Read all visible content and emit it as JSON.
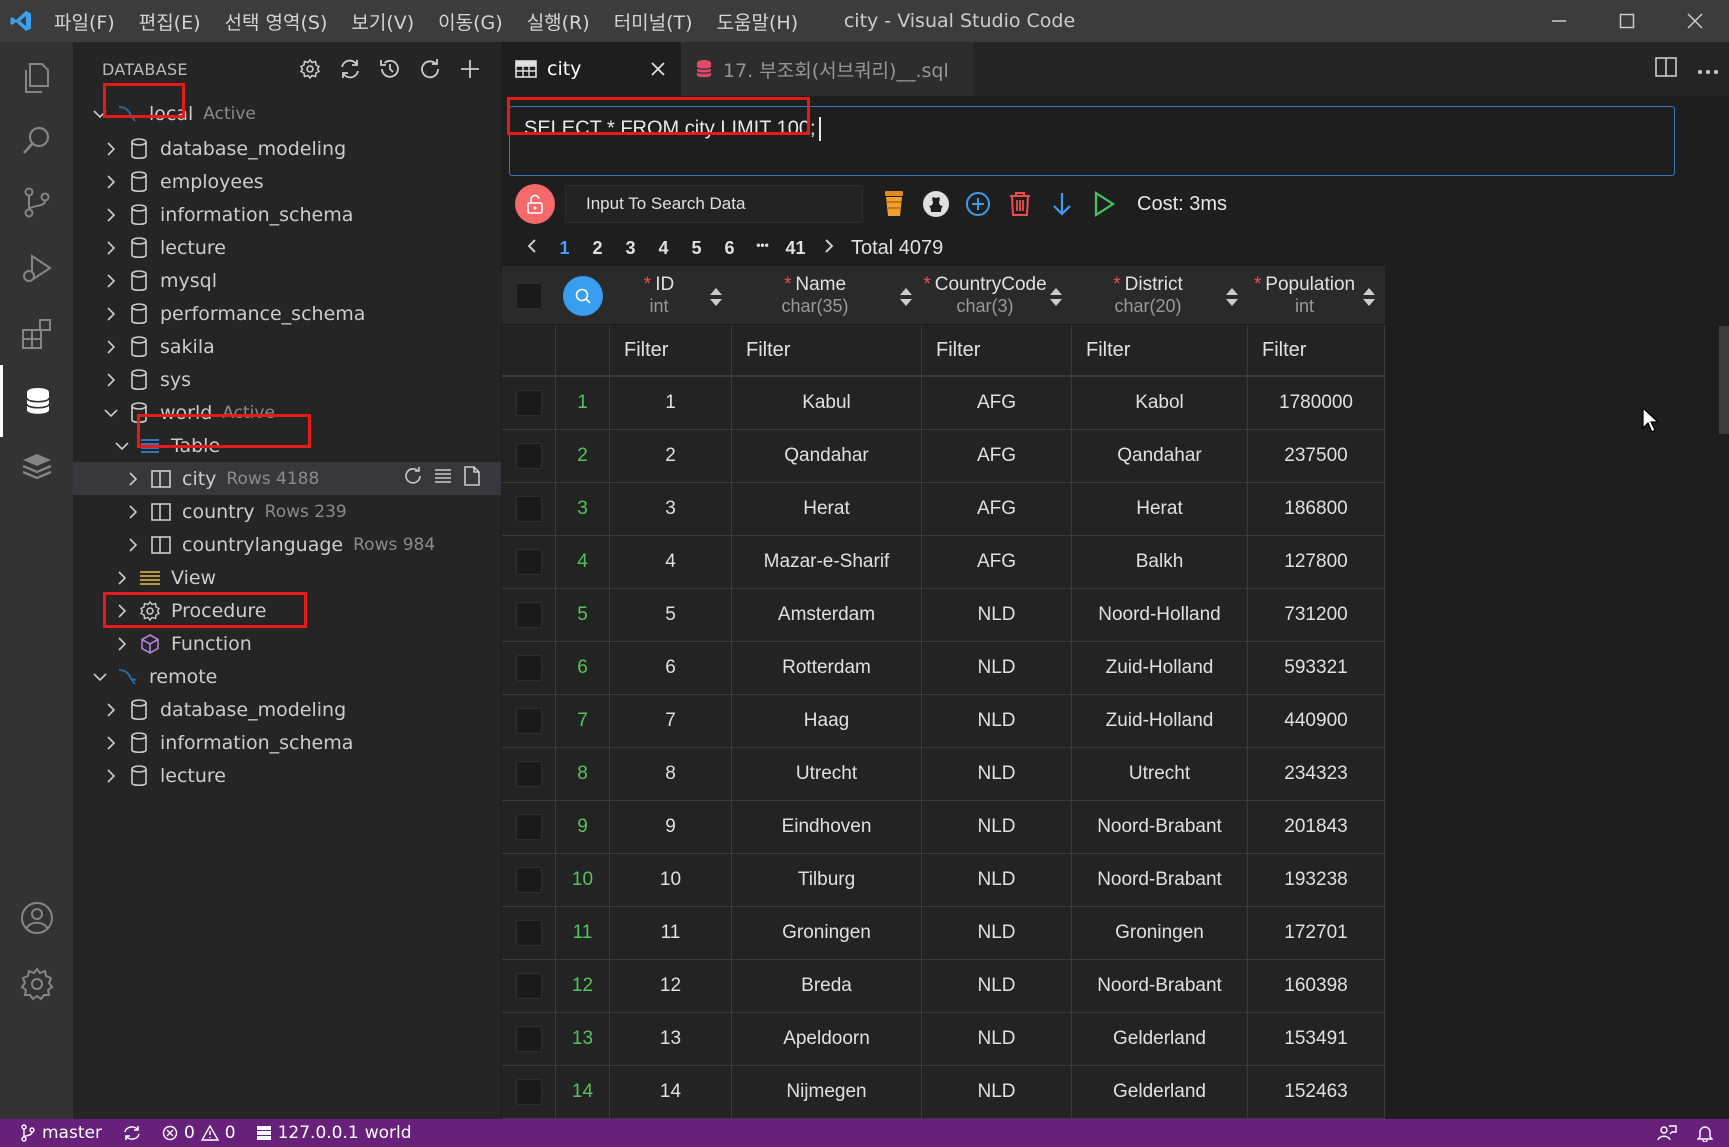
{
  "titlebar": {
    "menu": [
      "파일(F)",
      "편집(E)",
      "선택 영역(S)",
      "보기(V)",
      "이동(G)",
      "실행(R)",
      "터미널(T)",
      "도움말(H)"
    ],
    "title": "city - Visual Studio Code"
  },
  "sidebar": {
    "title": "DATABASE",
    "tree": [
      {
        "label": "local",
        "desc": "Active",
        "level": 0,
        "icon": "connection-icon",
        "expanded": true
      },
      {
        "label": "database_modeling",
        "level": 1,
        "icon": "database-icon"
      },
      {
        "label": "employees",
        "level": 1,
        "icon": "database-icon"
      },
      {
        "label": "information_schema",
        "level": 1,
        "icon": "database-icon"
      },
      {
        "label": "lecture",
        "level": 1,
        "icon": "database-icon"
      },
      {
        "label": "mysql",
        "level": 1,
        "icon": "database-icon"
      },
      {
        "label": "performance_schema",
        "level": 1,
        "icon": "database-icon"
      },
      {
        "label": "sakila",
        "level": 1,
        "icon": "database-icon"
      },
      {
        "label": "sys",
        "level": 1,
        "icon": "database-icon"
      },
      {
        "label": "world",
        "desc": "Active",
        "level": 1,
        "icon": "database-icon",
        "expanded": true
      },
      {
        "label": "Table",
        "level": 2,
        "icon": "table-group-icon",
        "expanded": true
      },
      {
        "label": "city",
        "desc": "Rows 4188",
        "level": 3,
        "icon": "table-icon"
      },
      {
        "label": "country",
        "desc": "Rows 239",
        "level": 3,
        "icon": "table-icon"
      },
      {
        "label": "countrylanguage",
        "desc": "Rows 984",
        "level": 3,
        "icon": "table-icon"
      },
      {
        "label": "View",
        "level": 2,
        "icon": "view-icon"
      },
      {
        "label": "Procedure",
        "level": 2,
        "icon": "procedure-icon"
      },
      {
        "label": "Function",
        "level": 2,
        "icon": "function-icon"
      },
      {
        "label": "remote",
        "level": 0,
        "icon": "connection-icon",
        "expanded": true
      },
      {
        "label": "database_modeling",
        "level": 1,
        "icon": "database-icon"
      },
      {
        "label": "information_schema",
        "level": 1,
        "icon": "database-icon"
      },
      {
        "label": "lecture",
        "level": 1,
        "icon": "database-icon"
      }
    ]
  },
  "tabs": [
    {
      "label": "city",
      "icon": "table-icon"
    },
    {
      "label": "17. 부조회(서브쿼리)__.sql",
      "icon": "database-icon"
    }
  ],
  "query": "SELECT * FROM city LIMIT 100;",
  "toolbar": {
    "search_placeholder": "Input To Search Data",
    "cost": "Cost: 3ms"
  },
  "pager": {
    "pages": [
      "1",
      "2",
      "3",
      "4",
      "5",
      "6",
      "•••",
      "41"
    ],
    "total": "Total 4079"
  },
  "grid": {
    "columns": [
      {
        "name": "ID",
        "type": "int"
      },
      {
        "name": "Name",
        "type": "char(35)"
      },
      {
        "name": "CountryCode",
        "type": "char(3)"
      },
      {
        "name": "District",
        "type": "char(20)"
      },
      {
        "name": "Population",
        "type": "int"
      }
    ],
    "filter_label": "Filter",
    "rows": [
      [
        "1",
        "1",
        "Kabul",
        "AFG",
        "Kabol",
        "1780000"
      ],
      [
        "2",
        "2",
        "Qandahar",
        "AFG",
        "Qandahar",
        "237500"
      ],
      [
        "3",
        "3",
        "Herat",
        "AFG",
        "Herat",
        "186800"
      ],
      [
        "4",
        "4",
        "Mazar-e-Sharif",
        "AFG",
        "Balkh",
        "127800"
      ],
      [
        "5",
        "5",
        "Amsterdam",
        "NLD",
        "Noord-Holland",
        "731200"
      ],
      [
        "6",
        "6",
        "Rotterdam",
        "NLD",
        "Zuid-Holland",
        "593321"
      ],
      [
        "7",
        "7",
        "Haag",
        "NLD",
        "Zuid-Holland",
        "440900"
      ],
      [
        "8",
        "8",
        "Utrecht",
        "NLD",
        "Utrecht",
        "234323"
      ],
      [
        "9",
        "9",
        "Eindhoven",
        "NLD",
        "Noord-Brabant",
        "201843"
      ],
      [
        "10",
        "10",
        "Tilburg",
        "NLD",
        "Noord-Brabant",
        "193238"
      ],
      [
        "11",
        "11",
        "Groningen",
        "NLD",
        "Groningen",
        "172701"
      ],
      [
        "12",
        "12",
        "Breda",
        "NLD",
        "Noord-Brabant",
        "160398"
      ],
      [
        "13",
        "13",
        "Apeldoorn",
        "NLD",
        "Gelderland",
        "153491"
      ],
      [
        "14",
        "14",
        "Nijmegen",
        "NLD",
        "Gelderland",
        "152463"
      ]
    ]
  },
  "statusbar": {
    "branch": "master",
    "errors": "0",
    "warnings": "0",
    "host": "127.0.0.1",
    "database": "world"
  },
  "colors": {
    "accent": "#4a9eff",
    "statusbar": "#68217a",
    "row_number": "#56c35a",
    "highlight_box": "#e51a1a"
  }
}
